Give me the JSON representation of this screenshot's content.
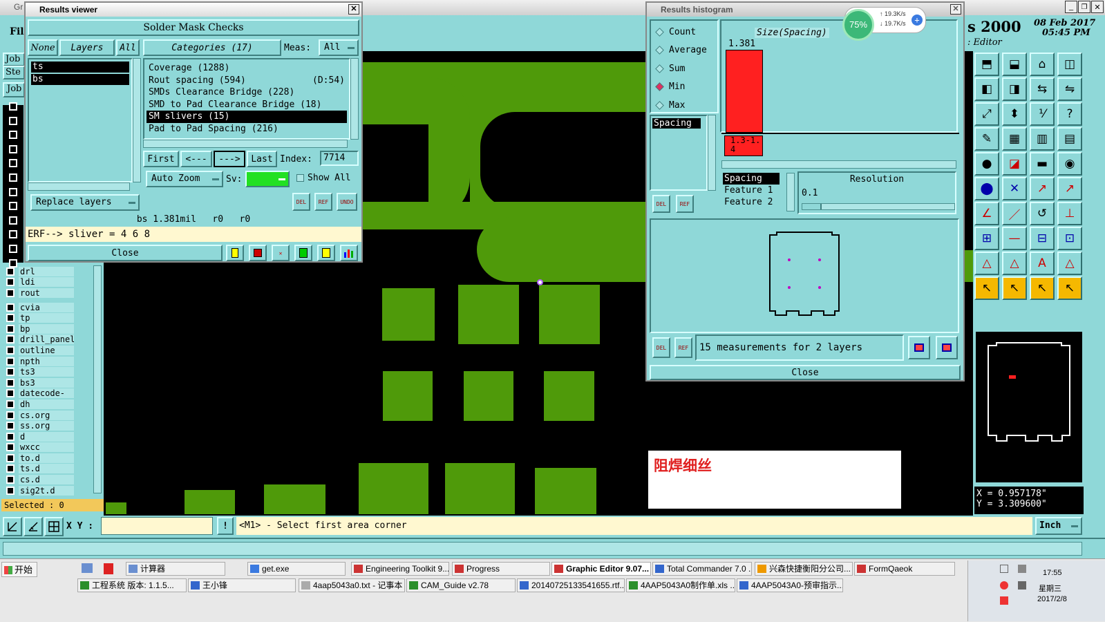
{
  "results_viewer": {
    "title": "Results viewer",
    "heading": "Solder Mask Checks",
    "btn_none": "None",
    "btn_layers": "Layers",
    "btn_all": "All",
    "categories_label": "Categories (17)",
    "meas_label": "Meas:",
    "meas_value": "All",
    "layers": [
      "ts",
      "bs"
    ],
    "categories": [
      {
        "name": "Coverage (1288)",
        "extra": ""
      },
      {
        "name": "Rout spacing (594)",
        "extra": "(D:54)"
      },
      {
        "name": "SMDs Clearance Bridge (228)",
        "extra": ""
      },
      {
        "name": "SMD to Pad Clearance Bridge (18)",
        "extra": ""
      },
      {
        "name": "SM slivers (15)",
        "extra": ""
      },
      {
        "name": "Pad to Pad Spacing (216)",
        "extra": ""
      }
    ],
    "first": "First",
    "prev": "<---",
    "next": "--->",
    "last": "Last",
    "index_label": "Index:",
    "index_value": "7714",
    "auto_zoom": "Auto Zoom",
    "sv_label": "Sv:",
    "show_all": "Show All",
    "replace_layers": "Replace layers",
    "status": "bs 1.381mil   r0   r0",
    "erf": "ERF--> sliver = 4 6 8",
    "close": "Close"
  },
  "histogram": {
    "title": "Results histogram",
    "stats": [
      "Count",
      "Average",
      "Sum",
      "Min",
      "Max"
    ],
    "selected_stat": "Min",
    "size_label": "Size(Spacing)",
    "bar_value": "1.381",
    "bar_range": "1.3-1.4",
    "list_item": "Spacing",
    "features": [
      "Spacing",
      "Feature 1",
      "Feature 2"
    ],
    "resolution_label": "Resolution",
    "resolution_value": "0.1",
    "measurements": "15 measurements for 2 layers",
    "close": "Close",
    "net_percent": "75%",
    "net_up": "19.3K/s",
    "net_down": "19.7K/s"
  },
  "header": {
    "app_prefix": "Gr",
    "date_year": "s 2000",
    "date": "08 Feb 2017",
    "time": "05:45 PM",
    "editor": ": Editor"
  },
  "left_panel": {
    "menu_file": "Fil",
    "job": "Job",
    "step": "Ste",
    "job2": "Job",
    "layers": [
      "drl",
      "ldi",
      "rout",
      "cvia",
      "tp",
      "bp",
      "drill_panel",
      "outline",
      "npth",
      "ts3",
      "bs3",
      "datecode-ts",
      "dh",
      "cs.org",
      "ss.org",
      "d",
      "wxcc",
      "to.d",
      "ts.d",
      "cs.d",
      "sig2t.d"
    ],
    "selected": "Selected : 0"
  },
  "annotation": "阻焊细丝",
  "coords": {
    "x": "X = 0.957178\"",
    "y": "Y = 3.309600\""
  },
  "bottom_bar": {
    "xy_label": "X Y :",
    "prompt": "<M1> - Select first area corner",
    "units": "Inch"
  },
  "taskbar": {
    "start": "开始",
    "row1": [
      "计算器",
      "get.exe",
      "Engineering Toolkit 9....",
      "Progress",
      "Graphic Editor 9.07...",
      "Total Commander 7.0 ...",
      "兴森快捷衡阳分公司...",
      "FormQaeok"
    ],
    "row2": [
      "工程系统  版本: 1.1.5...",
      "王小锋",
      "4aap5043a0.txt - 记事本",
      "CAM_Guide v2.78",
      "20140725133541655.rtf...",
      "4AAP5043A0制作单.xls ...",
      "4AAP5043A0-预审指示...."
    ],
    "clock": "17:55",
    "weekday": "星期三",
    "date": "2017/2/8"
  },
  "colors": {
    "teal": "#8fd8d8",
    "pcb_green": "#4f9a0a",
    "highlight": "#ff2020"
  }
}
